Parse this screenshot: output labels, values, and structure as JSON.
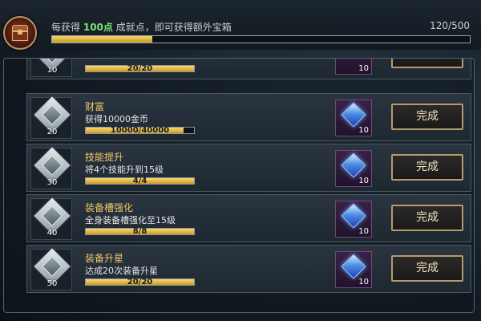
{
  "header": {
    "hint_prefix": "每获得",
    "hint_points": "100点",
    "hint_suffix": "成就点，即可获得额外宝箱",
    "progress_text": "120/500",
    "progress_value": 120,
    "progress_max": 500
  },
  "partial_row": {
    "level": "10",
    "progress_text": "20/20",
    "reward_qty": "10"
  },
  "rows": [
    {
      "level": "20",
      "title": "财富",
      "desc": "获得10000金币",
      "progress_text": "10000/40000",
      "progress_fraction": 0.9,
      "reward_qty": "10",
      "button": "完成"
    },
    {
      "level": "30",
      "title": "技能提升",
      "desc": "将4个技能升到15级",
      "progress_text": "4/4",
      "progress_fraction": 1.0,
      "reward_qty": "10",
      "button": "完成"
    },
    {
      "level": "40",
      "title": "装备槽强化",
      "desc": "全身装备槽强化至15级",
      "progress_text": "8/8",
      "progress_fraction": 1.0,
      "reward_qty": "10",
      "button": "完成"
    },
    {
      "level": "50",
      "title": "装备升星",
      "desc": "达成20次装备升星",
      "progress_text": "20/20",
      "progress_fraction": 1.0,
      "reward_qty": "10",
      "button": "完成"
    }
  ],
  "colors": {
    "title": "#f1c86a",
    "points": "#7ee07a",
    "bar_fill": "#e3b845",
    "gem": "#4e8fe6"
  },
  "icons": {
    "chest": "treasure-chest-icon",
    "badge": "silver-diamond-badge-icon",
    "reward": "blue-gem-icon"
  }
}
